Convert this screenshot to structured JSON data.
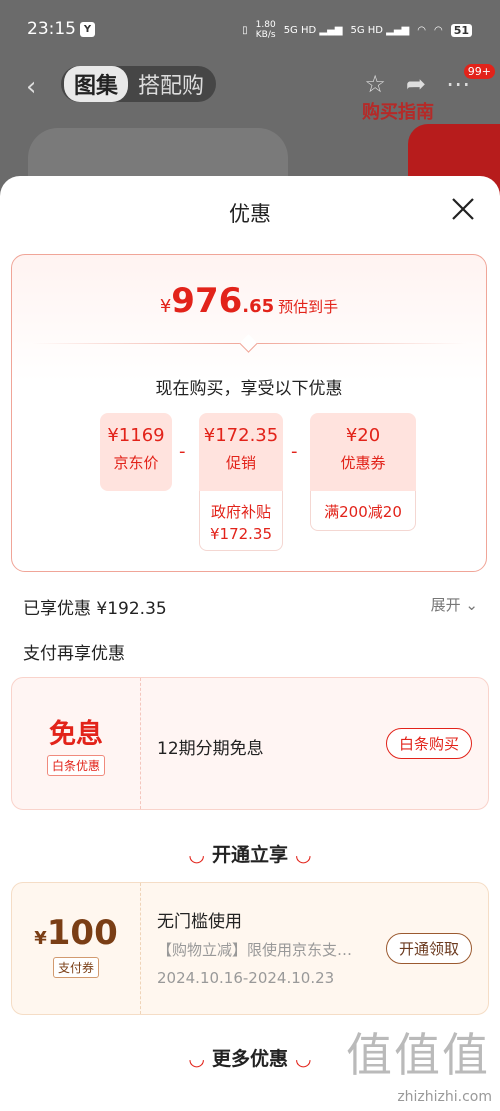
{
  "status": {
    "time": "23:15",
    "speed_value": "1.80",
    "speed_unit": "KB/s",
    "network": "5G HD",
    "battery": "51"
  },
  "bg": {
    "tab_active": "图集",
    "tab_other": "搭配购",
    "badge": "99+",
    "banner_text": "购买指南"
  },
  "sheet": {
    "title": "优惠"
  },
  "price": {
    "yen": "¥",
    "int": "976",
    "dec": ".65",
    "tag": "预估到手",
    "subtitle": "现在购买，享受以下优惠"
  },
  "boxes": [
    {
      "value": "¥1169",
      "label": "京东价"
    },
    {
      "value": "¥172.35",
      "label": "促销",
      "detail1": "政府补贴",
      "detail2": "¥172.35"
    },
    {
      "value": "¥20",
      "label": "优惠券",
      "detail1": "满200减20"
    }
  ],
  "ops": [
    "-",
    "-"
  ],
  "enjoyed": "已享优惠 ¥192.35",
  "expand": "展开",
  "pay_title": "支付再享优惠",
  "interest_free": {
    "big": "免息",
    "tag": "白条优惠",
    "desc": "12期分期免息",
    "button": "白条购买"
  },
  "section1": "开通立享",
  "pay_coupon": {
    "yen": "¥",
    "amount": "100",
    "tag": "支付券",
    "title": "无门槛使用",
    "desc": "【购物立减】限使用京东支…",
    "dates": "2024.10.16-2024.10.23",
    "button": "开通领取"
  },
  "section2": "更多优惠",
  "watermark": "zhizhizhi.com",
  "watermark_big": "值值值",
  "colors": {
    "accent": "#e2231a",
    "brown": "#7a3e15"
  }
}
